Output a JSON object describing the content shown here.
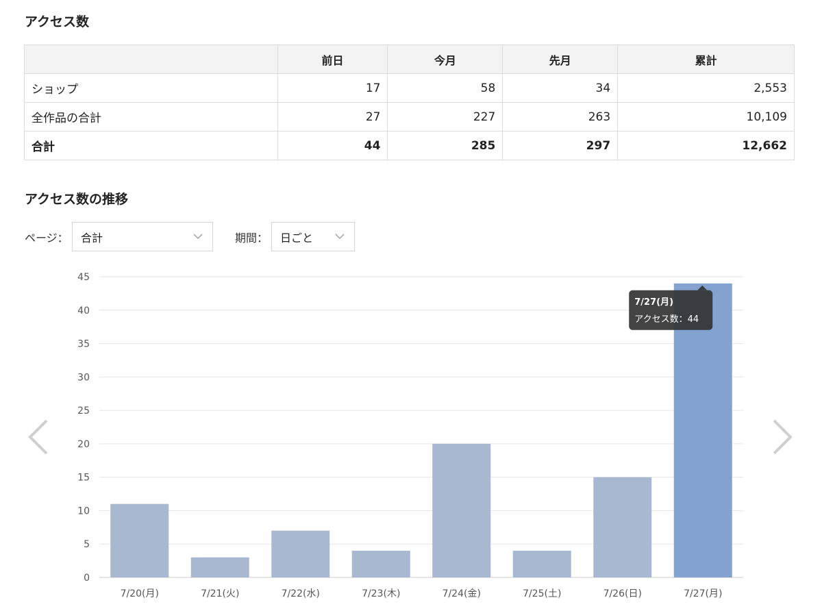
{
  "summary": {
    "title": "アクセス数",
    "headers": [
      "",
      "前日",
      "今月",
      "先月",
      "累計"
    ],
    "rows": [
      {
        "label": "ショップ",
        "values": [
          "17",
          "58",
          "34",
          "2,553"
        ]
      },
      {
        "label": "全作品の合計",
        "values": [
          "27",
          "227",
          "263",
          "10,109"
        ]
      }
    ],
    "total": {
      "label": "合計",
      "values": [
        "44",
        "285",
        "297",
        "12,662"
      ]
    }
  },
  "trend": {
    "title": "アクセス数の推移",
    "page_filter": {
      "label": "ページ：",
      "value": "合計"
    },
    "period_filter": {
      "label": "期間：",
      "value": "日ごと"
    }
  },
  "tooltip": {
    "date": "7/27(月)",
    "text": "アクセス数：44"
  },
  "colors": {
    "bar": "#a9b8d1",
    "bar_active": "#84a2d0",
    "tooltip_bg": "#333333",
    "grid": "#e6e6e6",
    "arrow": "#cfcfcf"
  },
  "chart_data": {
    "type": "bar",
    "categories": [
      "7/20(月)",
      "7/21(火)",
      "7/22(水)",
      "7/23(木)",
      "7/24(金)",
      "7/25(土)",
      "7/26(日)",
      "7/27(月)"
    ],
    "values": [
      11,
      3,
      7,
      4,
      20,
      4,
      15,
      44
    ],
    "ylim": [
      0,
      45
    ],
    "yticks": [
      0,
      5,
      10,
      15,
      20,
      25,
      30,
      35,
      40,
      45
    ],
    "highlighted_category": "7/27(月)",
    "grid": true
  }
}
